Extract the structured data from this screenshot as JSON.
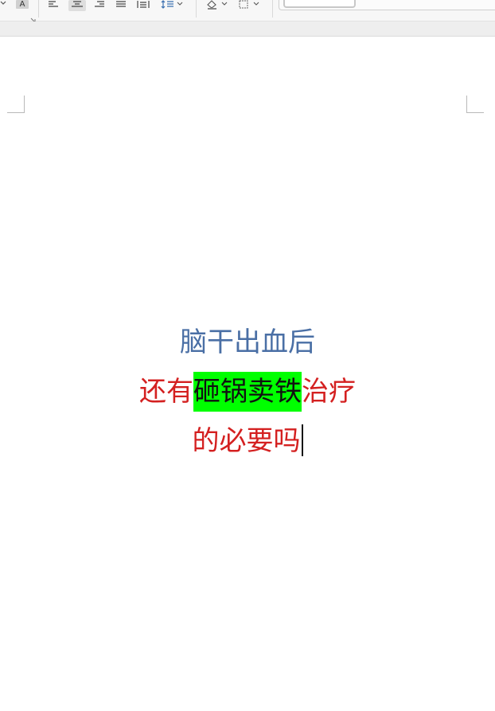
{
  "toolbar": {
    "font_color_letter": "A",
    "groups": [
      "font-group",
      "paragraph-group",
      "shading-borders-group",
      "styles-group"
    ]
  },
  "document": {
    "lines": [
      {
        "segments": [
          {
            "text": "脑干出血后",
            "color": "#4a6fa5",
            "highlight": null
          }
        ]
      },
      {
        "segments": [
          {
            "text": "还有",
            "color": "#d42020",
            "highlight": null
          },
          {
            "text": "砸锅卖铁",
            "color": "#111111",
            "highlight": "#00ff00"
          },
          {
            "text": "治疗",
            "color": "#d42020",
            "highlight": null
          }
        ]
      },
      {
        "segments": [
          {
            "text": "的必要吗",
            "color": "#d42020",
            "highlight": null
          }
        ],
        "caret": true
      }
    ]
  },
  "colors": {
    "ribbon_bg": "#f7f7f7",
    "page_bg": "#ffffff",
    "title_blue": "#4a6fa5",
    "text_red": "#d42020",
    "highlight_green": "#00ff00"
  }
}
